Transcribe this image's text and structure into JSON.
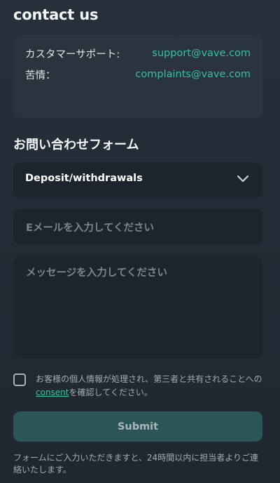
{
  "header": {
    "title": "contact us"
  },
  "contacts": [
    {
      "label": "カスタマーサポート:",
      "value": "support@vave.com"
    },
    {
      "label": "苦情：",
      "value": "complaints@vave.com"
    }
  ],
  "form": {
    "title": "お問い合わせフォーム",
    "topic_select": {
      "value": "Deposit/withdrawals",
      "icon": "chevron-down-icon"
    },
    "email_placeholder": "Eメールを入力してください",
    "message_placeholder": "メッセージを入力してください",
    "consent": {
      "checked": false,
      "text_before": "お客様の個人情報が処理され、第三者と共有されることへの",
      "link_text": "consent",
      "text_after": "を確認してください。"
    },
    "submit_label": "Submit",
    "footer_note": "フォームにご入力いただきますと、24時間以内に担当者よりご連絡いたします。"
  },
  "colors": {
    "accent": "#35c2a1",
    "submit_bg": "#2b5559",
    "field_bg": "#1c252d",
    "card_bg": "#2a343e"
  }
}
